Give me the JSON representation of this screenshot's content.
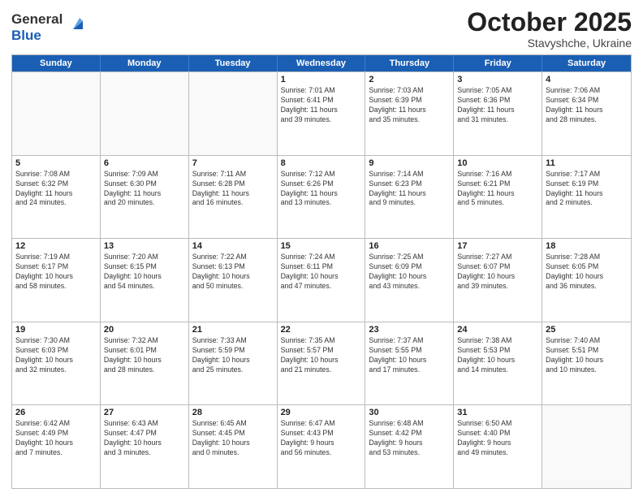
{
  "header": {
    "logo_general": "General",
    "logo_blue": "Blue",
    "month_title": "October 2025",
    "location": "Stavyshche, Ukraine"
  },
  "weekdays": [
    "Sunday",
    "Monday",
    "Tuesday",
    "Wednesday",
    "Thursday",
    "Friday",
    "Saturday"
  ],
  "weeks": [
    [
      {
        "day": "",
        "info": ""
      },
      {
        "day": "",
        "info": ""
      },
      {
        "day": "",
        "info": ""
      },
      {
        "day": "1",
        "info": "Sunrise: 7:01 AM\nSunset: 6:41 PM\nDaylight: 11 hours\nand 39 minutes."
      },
      {
        "day": "2",
        "info": "Sunrise: 7:03 AM\nSunset: 6:39 PM\nDaylight: 11 hours\nand 35 minutes."
      },
      {
        "day": "3",
        "info": "Sunrise: 7:05 AM\nSunset: 6:36 PM\nDaylight: 11 hours\nand 31 minutes."
      },
      {
        "day": "4",
        "info": "Sunrise: 7:06 AM\nSunset: 6:34 PM\nDaylight: 11 hours\nand 28 minutes."
      }
    ],
    [
      {
        "day": "5",
        "info": "Sunrise: 7:08 AM\nSunset: 6:32 PM\nDaylight: 11 hours\nand 24 minutes."
      },
      {
        "day": "6",
        "info": "Sunrise: 7:09 AM\nSunset: 6:30 PM\nDaylight: 11 hours\nand 20 minutes."
      },
      {
        "day": "7",
        "info": "Sunrise: 7:11 AM\nSunset: 6:28 PM\nDaylight: 11 hours\nand 16 minutes."
      },
      {
        "day": "8",
        "info": "Sunrise: 7:12 AM\nSunset: 6:26 PM\nDaylight: 11 hours\nand 13 minutes."
      },
      {
        "day": "9",
        "info": "Sunrise: 7:14 AM\nSunset: 6:23 PM\nDaylight: 11 hours\nand 9 minutes."
      },
      {
        "day": "10",
        "info": "Sunrise: 7:16 AM\nSunset: 6:21 PM\nDaylight: 11 hours\nand 5 minutes."
      },
      {
        "day": "11",
        "info": "Sunrise: 7:17 AM\nSunset: 6:19 PM\nDaylight: 11 hours\nand 2 minutes."
      }
    ],
    [
      {
        "day": "12",
        "info": "Sunrise: 7:19 AM\nSunset: 6:17 PM\nDaylight: 10 hours\nand 58 minutes."
      },
      {
        "day": "13",
        "info": "Sunrise: 7:20 AM\nSunset: 6:15 PM\nDaylight: 10 hours\nand 54 minutes."
      },
      {
        "day": "14",
        "info": "Sunrise: 7:22 AM\nSunset: 6:13 PM\nDaylight: 10 hours\nand 50 minutes."
      },
      {
        "day": "15",
        "info": "Sunrise: 7:24 AM\nSunset: 6:11 PM\nDaylight: 10 hours\nand 47 minutes."
      },
      {
        "day": "16",
        "info": "Sunrise: 7:25 AM\nSunset: 6:09 PM\nDaylight: 10 hours\nand 43 minutes."
      },
      {
        "day": "17",
        "info": "Sunrise: 7:27 AM\nSunset: 6:07 PM\nDaylight: 10 hours\nand 39 minutes."
      },
      {
        "day": "18",
        "info": "Sunrise: 7:28 AM\nSunset: 6:05 PM\nDaylight: 10 hours\nand 36 minutes."
      }
    ],
    [
      {
        "day": "19",
        "info": "Sunrise: 7:30 AM\nSunset: 6:03 PM\nDaylight: 10 hours\nand 32 minutes."
      },
      {
        "day": "20",
        "info": "Sunrise: 7:32 AM\nSunset: 6:01 PM\nDaylight: 10 hours\nand 28 minutes."
      },
      {
        "day": "21",
        "info": "Sunrise: 7:33 AM\nSunset: 5:59 PM\nDaylight: 10 hours\nand 25 minutes."
      },
      {
        "day": "22",
        "info": "Sunrise: 7:35 AM\nSunset: 5:57 PM\nDaylight: 10 hours\nand 21 minutes."
      },
      {
        "day": "23",
        "info": "Sunrise: 7:37 AM\nSunset: 5:55 PM\nDaylight: 10 hours\nand 17 minutes."
      },
      {
        "day": "24",
        "info": "Sunrise: 7:38 AM\nSunset: 5:53 PM\nDaylight: 10 hours\nand 14 minutes."
      },
      {
        "day": "25",
        "info": "Sunrise: 7:40 AM\nSunset: 5:51 PM\nDaylight: 10 hours\nand 10 minutes."
      }
    ],
    [
      {
        "day": "26",
        "info": "Sunrise: 6:42 AM\nSunset: 4:49 PM\nDaylight: 10 hours\nand 7 minutes."
      },
      {
        "day": "27",
        "info": "Sunrise: 6:43 AM\nSunset: 4:47 PM\nDaylight: 10 hours\nand 3 minutes."
      },
      {
        "day": "28",
        "info": "Sunrise: 6:45 AM\nSunset: 4:45 PM\nDaylight: 10 hours\nand 0 minutes."
      },
      {
        "day": "29",
        "info": "Sunrise: 6:47 AM\nSunset: 4:43 PM\nDaylight: 9 hours\nand 56 minutes."
      },
      {
        "day": "30",
        "info": "Sunrise: 6:48 AM\nSunset: 4:42 PM\nDaylight: 9 hours\nand 53 minutes."
      },
      {
        "day": "31",
        "info": "Sunrise: 6:50 AM\nSunset: 4:40 PM\nDaylight: 9 hours\nand 49 minutes."
      },
      {
        "day": "",
        "info": ""
      }
    ]
  ]
}
